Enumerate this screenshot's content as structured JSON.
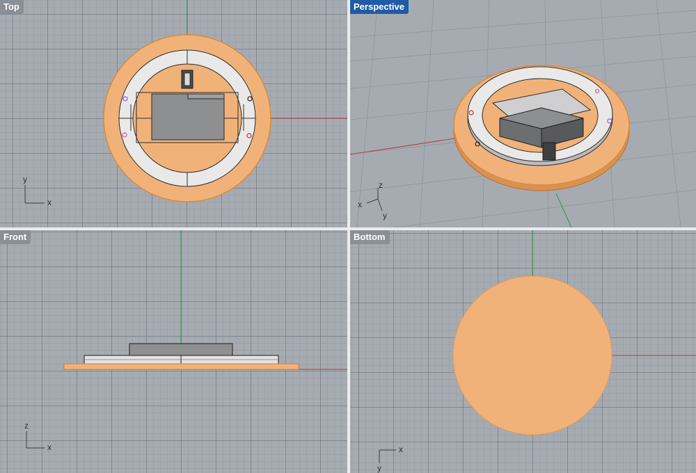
{
  "viewports": {
    "top": {
      "label": "Top",
      "active": false,
      "axes": {
        "vertical": "y",
        "horizontal": "x"
      }
    },
    "perspective": {
      "label": "Perspective",
      "active": true,
      "axes": {
        "horizontal": "x",
        "vertical": "z",
        "depth": "y"
      }
    },
    "front": {
      "label": "Front",
      "active": false,
      "axes": {
        "vertical": "z",
        "horizontal": "x"
      }
    },
    "bottom": {
      "label": "Bottom",
      "active": false,
      "axes": {
        "horizontal": "x",
        "vertical": "y"
      }
    }
  },
  "colors": {
    "grid_background": "#a6abb2",
    "base_disc": "#f1b27a",
    "base_disc_edge": "#d88a3f",
    "ring": "#e9e9ea",
    "inner_block": "#8e8f91",
    "x_axis": "#b8383c",
    "y_axis": "#2f9a46",
    "active_label": "#1f5ba6",
    "inactive_label": "#8b8f96"
  },
  "icons": [
    "top-axis-gizmo",
    "perspective-axis-gizmo",
    "front-axis-gizmo",
    "bottom-axis-gizmo"
  ]
}
